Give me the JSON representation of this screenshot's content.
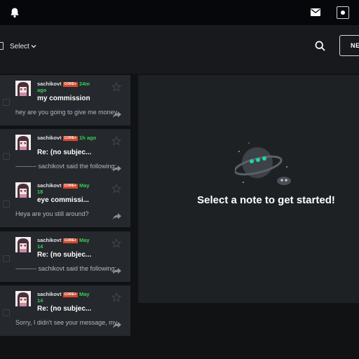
{
  "header": {
    "icons": [
      "bell-icon",
      "mail-icon",
      "user-icon"
    ]
  },
  "toolbar": {
    "select_label": "Select",
    "new_label": "NEW"
  },
  "notes": [
    {
      "username": "sachikovt",
      "badge": "CORE+",
      "time_line1": "24m",
      "time_line2": "ago",
      "subject": "my commission",
      "preview": "hey are you going to give me money"
    },
    {
      "username": "sachikovt",
      "badge": "CORE+",
      "time_line1": "1h ago",
      "time_line2": "",
      "subject": "Re: (no subjec...",
      "preview": "---------- sachikovt said the following:"
    },
    {
      "username": "sachikovt",
      "badge": "CORE+",
      "time_line1": "May",
      "time_line2": "18",
      "subject": "eye commissi...",
      "preview": "Heya are you still around?"
    },
    {
      "username": "sachikovt",
      "badge": "CORE+",
      "time_line1": "May",
      "time_line2": "14",
      "subject": "Re: (no subjec...",
      "preview": "---------- sachikovt said the following:"
    },
    {
      "username": "sachikovt",
      "badge": "CORE+",
      "time_line1": "May",
      "time_line2": "14",
      "subject": "Re: (no subjec...",
      "preview": "Sorry, I didn't see your message, my"
    }
  ],
  "empty_state": {
    "message": "Select a note to get started!"
  },
  "colors": {
    "accent_green": "#33d05c",
    "badge_orange": "#d5492f",
    "card_bg": "#25282c"
  }
}
